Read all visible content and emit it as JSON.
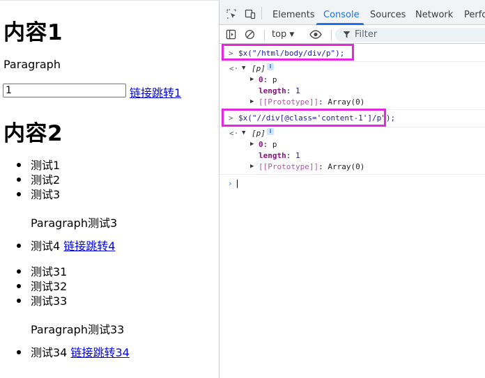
{
  "page": {
    "heading1": "内容1",
    "paragraph1": "Paragraph",
    "input_value": "1",
    "link1": "链接跳转1",
    "heading2": "内容2",
    "list1": [
      "测试1",
      "测试2",
      "测试3"
    ],
    "para_test3": "Paragraph测试3",
    "item4_text": "测试4",
    "item4_link": "链接跳转4",
    "list2": [
      "测试31",
      "测试32",
      "测试33"
    ],
    "para_test33": "Paragraph测试33",
    "item34_text": "测试34",
    "item34_link": "链接跳转34"
  },
  "devtools": {
    "tabs": [
      "Elements",
      "Console",
      "Sources",
      "Network",
      "Perfo"
    ],
    "active_tab": "Console",
    "context": "top",
    "filter_placeholder": "Filter",
    "commands": [
      {
        "input": "$x(\"/html/body/div/p\");",
        "result_summary": "[p]",
        "item0_key": "0",
        "item0_val": "p",
        "length_key": "length",
        "length_val": "1",
        "proto_key": "[[Prototype]]",
        "proto_val": "Array(0)"
      },
      {
        "input": "$x(\"//div[@class='content-1']/p\");",
        "result_summary": "[p]",
        "item0_key": "0",
        "item0_val": "p",
        "length_key": "length",
        "length_val": "1",
        "proto_key": "[[Prototype]]",
        "proto_val": "Array(0)"
      }
    ],
    "info_badge": "i",
    "colors": {
      "accent": "#1a73e8",
      "highlight": "#e627e0",
      "key": "#881280",
      "string": "#1a1aa6"
    }
  }
}
